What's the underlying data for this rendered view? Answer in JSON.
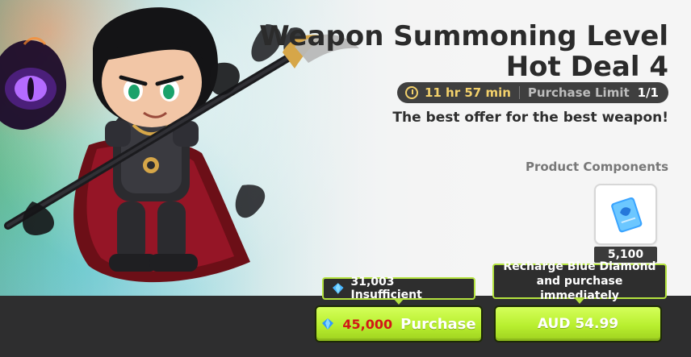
{
  "colors": {
    "title_text": "#2b2b2b",
    "timer_accent": "#f3d16b",
    "button_green": "#b8ef2f",
    "price_red": "#d11717",
    "bar_dark": "#2e2e2f",
    "callout_border": "#b4e33f"
  },
  "offer": {
    "title_line1": "Weapon Summoning Level",
    "title_line2": "Hot Deal 4",
    "timer": "11 hr 57 min",
    "limit_label": "Purchase Limit",
    "limit_value": "1/1",
    "subtitle": "The best offer for the best weapon!"
  },
  "product": {
    "components_label": "Product Components",
    "item_icon": "blue-diamond-card-icon",
    "item_qty": "5,100"
  },
  "balance": {
    "callout_text": "31,003 Insufficient",
    "icon": "blue-diamond-icon"
  },
  "purchase": {
    "price": "45,000",
    "label": "Purchase",
    "price_icon": "blue-diamond-icon"
  },
  "recharge": {
    "callout_line1": "Recharge Blue Diamond",
    "callout_line2": "and purchase immediately",
    "button_label": "AUD 54.99"
  }
}
